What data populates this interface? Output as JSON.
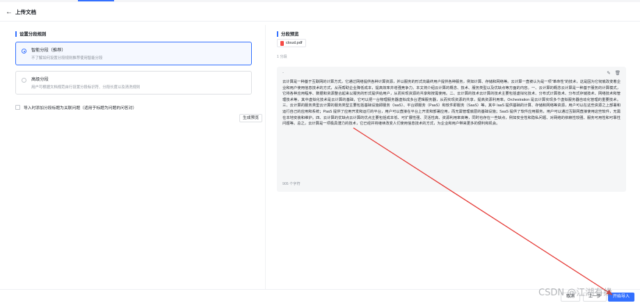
{
  "header": {
    "back_icon": "arrow-left-icon",
    "title": "上传文档"
  },
  "left": {
    "section_title": "设置分段规则",
    "options": [
      {
        "title": "智能分段（推荐）",
        "desc": "不了解如何设置分段规则推荐使用智能分段",
        "selected": true
      },
      {
        "title": "高级分段",
        "desc": "用户可根据文档规范自行设置分段标识符、分段长度以及清洗规则",
        "selected": false
      }
    ],
    "checkbox_label": "导入时添加分段标题为关联问题（适用于标题为问题的问答对）",
    "checkbox_checked": false,
    "generate_button": "生成预览"
  },
  "right": {
    "section_title": "分段预览",
    "file_name": "cloud.pdf",
    "segment_count": "1 分段",
    "segment_dash": "-",
    "edit_icon": "edit-icon",
    "delete_icon": "trash-icon",
    "segment_text": "云计算是一种基于互联网的计算方式，它通过网络提供各种计算资源，并以服务的形式向最终用户提供各种服务，例如计算、存储和网络等。云计算一直被认为是一项\"革命性\"的技术，这是因为它彻底改变着企业和用户使用信息技术的方式，从而帮助企业降低成本，提高效率并增强竞争力。本文将介绍云计算的概念、技术、服务类型以及优缺点等方面的内容。一、云计算的概念云计算是一种基于服务的计算模式，它将各种应用程序、数据和资源整合起来以服务的形式提供给用户，从而实现资源的共享和按需使用。二、云计算的技术云计算的技术主要包括虚拟化技术、分布式计算技术、分布式存储技术、网络技术和管理技术等，其中虚拟化技术是云计算的基础，它可以把一台物理服务器虚拟成多台逻辑服务器，从而实现资源的共享，提高资源利用率。Orchestration 是云计算实现多个虚拟服务器自动化管理的重要技术。三、云计算的服务类型云计算的服务类型主要包括基础设施即服务（IaaS）、平台即服务（PaaS）和软件即服务（SaaS）等。其中 IaaS 提供基础的计算、存储和网络等资源，用户可以在这些资源之上部署和运行自己的应用和系统；PaaS 提供了应用开发和运行的平台，用户可以直接在平台上开发和部署应用，而无需管理底层的基础设施；SaaS 提供了软件应用服务，用户可以通过互联网直接使用这些软件，无需在本地安装和维护。四、云计算的优缺点云计算的优点主要包括成本低、可扩展性强、灵活性高、资源利用率高等，同时也存在一些缺点，例如安全性和隐私问题、对网络的依赖性较强、服务可用性和可靠性问题等。总之，云计算是一项极具潜力的技术，它已经并将继续改变人们使用信息技术的方式，为企业和用户带来更多的便利和机会。",
    "char_count": "905 个字符"
  },
  "footer": {
    "cancel": "取消",
    "prev": "上一步",
    "next": "开始导入"
  },
  "watermark": "CSDN @江湖有缘",
  "colors": {
    "accent": "#3370ff",
    "annotation_arrow": "#e53935"
  }
}
